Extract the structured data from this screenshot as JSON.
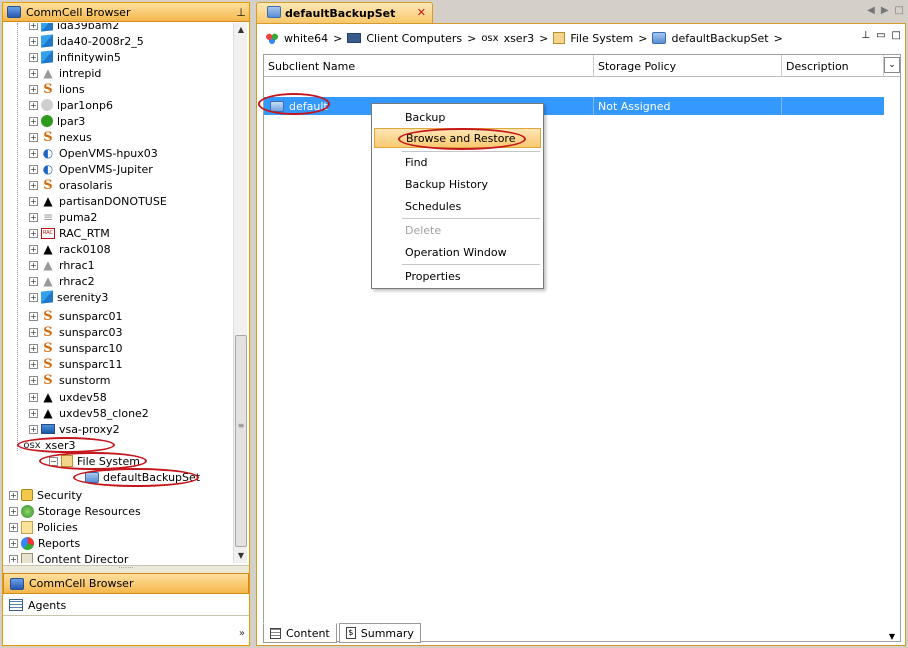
{
  "left_panel": {
    "title": "CommCell Browser",
    "pin_glyph": "⊥",
    "tree": [
      {
        "label": "ida39bam2",
        "icon": "windows-icon",
        "partial": true
      },
      {
        "label": "ida40-2008r2_5",
        "icon": "windows-icon"
      },
      {
        "label": "infinitywin5",
        "icon": "windows-icon"
      },
      {
        "label": "intrepid",
        "icon": "gray-linux-icon"
      },
      {
        "label": "lions",
        "icon": "solaris-icon"
      },
      {
        "label": "lpar1onp6",
        "icon": "aix-gray-icon"
      },
      {
        "label": "lpar3",
        "icon": "aix-icon"
      },
      {
        "label": "nexus",
        "icon": "solaris-icon"
      },
      {
        "label": "OpenVMS-hpux03",
        "icon": "hp-icon"
      },
      {
        "label": "OpenVMS-Jupiter",
        "icon": "hp-icon"
      },
      {
        "label": "orasolaris",
        "icon": "solaris-icon"
      },
      {
        "label": "partisanDONOTUSE",
        "icon": "linux-icon"
      },
      {
        "label": "puma2",
        "icon": "gray-server-icon"
      },
      {
        "label": "RAC_RTM",
        "icon": "rac-icon"
      },
      {
        "label": "rack0108",
        "icon": "linux-icon"
      },
      {
        "label": "rhrac1",
        "icon": "gray-linux-icon"
      },
      {
        "label": "rhrac2",
        "icon": "gray-linux-icon"
      },
      {
        "label": "serenity3",
        "icon": "windows-icon"
      },
      {
        "label": "sunsparc01",
        "icon": "solaris-icon"
      },
      {
        "label": "sunsparc03",
        "icon": "solaris-icon"
      },
      {
        "label": "sunsparc10",
        "icon": "solaris-icon"
      },
      {
        "label": "sunsparc11",
        "icon": "solaris-icon"
      },
      {
        "label": "sunstorm",
        "icon": "solaris-icon"
      },
      {
        "label": "uxdev58",
        "icon": "linux-icon"
      },
      {
        "label": "uxdev58_clone2",
        "icon": "linux-icon"
      },
      {
        "label": "vsa-proxy2",
        "icon": "vm-icon"
      }
    ],
    "expanded": {
      "client_prefix": "osx",
      "client": "xser3",
      "agent": "File System",
      "backupset": "defaultBackupSet"
    },
    "root_nodes": [
      "Security",
      "Storage Resources",
      "Policies",
      "Reports",
      "Content Director"
    ],
    "nav_buttons": {
      "commcell": "CommCell Browser",
      "agents": "Agents"
    },
    "more_glyph": "»"
  },
  "tab": {
    "title": "defaultBackupSet",
    "close": "✕"
  },
  "tab_controls": {
    "prev": "◀",
    "next": "▶",
    "max": "□"
  },
  "breadcrumb": {
    "items": [
      "white64",
      "Client Computers",
      "xser3",
      "File System",
      "defaultBackupSet"
    ],
    "client_prefix": "osx",
    "separator": ">"
  },
  "view_controls": {
    "pin": "⊥",
    "restore": "▭",
    "max": "□"
  },
  "grid": {
    "columns": [
      "Subclient Name",
      "Storage Policy",
      "Description"
    ],
    "chooser": "⌄",
    "rows": [
      {
        "name": "default",
        "policy": "Not Assigned",
        "description": ""
      }
    ]
  },
  "context_menu": {
    "items": [
      "Backup",
      "Browse and Restore",
      "Find",
      "Backup History",
      "Schedules",
      "Delete",
      "Operation Window",
      "Properties"
    ]
  },
  "bottom_tabs": {
    "content": "Content",
    "summary": "Summary"
  },
  "colors": {
    "accent": "#f6b74c",
    "selection": "#3399ff",
    "annotation": "#c4161c"
  }
}
